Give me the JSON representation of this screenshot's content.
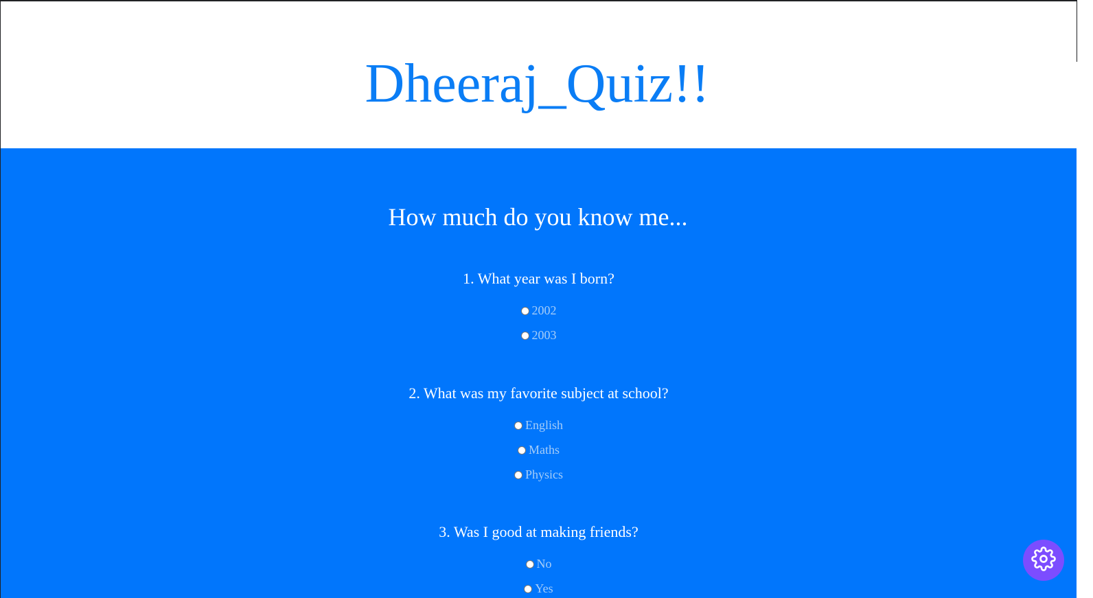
{
  "header": {
    "title": "Dheeraj_Quiz!!"
  },
  "main": {
    "subtitle": "How much do you know me...",
    "questions": [
      {
        "text": "1. What year was I born?",
        "options": [
          "2002",
          "2003"
        ]
      },
      {
        "text": "2. What was my favorite subject at school?",
        "options": [
          "English",
          "Maths",
          "Physics"
        ]
      },
      {
        "text": "3. Was I good at making friends?",
        "options": [
          "No",
          "Yes"
        ]
      }
    ]
  },
  "fab": {
    "icon": "gear-icon",
    "color": "#7c4dff"
  },
  "colors": {
    "accent": "#0176fc",
    "title": "#0a7df5",
    "option_text": "#a6cdf8"
  }
}
